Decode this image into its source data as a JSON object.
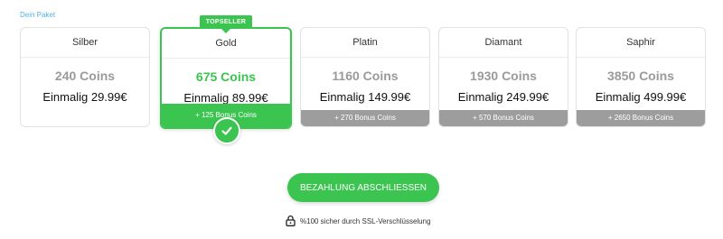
{
  "section_label": "Dein Paket",
  "topseller_label": "TOPSELLER",
  "packages": [
    {
      "name": "Silber",
      "coins": "240 Coins",
      "price": "Einmalig 29.99€",
      "bonus": ""
    },
    {
      "name": "Gold",
      "coins": "675 Coins",
      "price": "Einmalig 89.99€",
      "bonus": "+ 125 Bonus Coins"
    },
    {
      "name": "Platin",
      "coins": "1160 Coins",
      "price": "Einmalig 149.99€",
      "bonus": "+ 270 Bonus Coins"
    },
    {
      "name": "Diamant",
      "coins": "1930 Coins",
      "price": "Einmalig 249.99€",
      "bonus": "+ 570 Bonus Coins"
    },
    {
      "name": "Saphir",
      "coins": "3850 Coins",
      "price": "Einmalig 499.99€",
      "bonus": "+ 2650 Bonus Coins"
    }
  ],
  "selected_package": "Gold",
  "pay_button_label": "BEZAHLUNG ABSCHLIESSEN",
  "ssl_text": "%100 sicher durch SSL-Verschlüsselung",
  "colors": {
    "accent": "#3cc450",
    "bonus_bar": "#9d9d9d",
    "link_blue": "#4fb3e0"
  },
  "icons": {
    "selected_check": "check-icon",
    "ssl": "lock-icon"
  }
}
